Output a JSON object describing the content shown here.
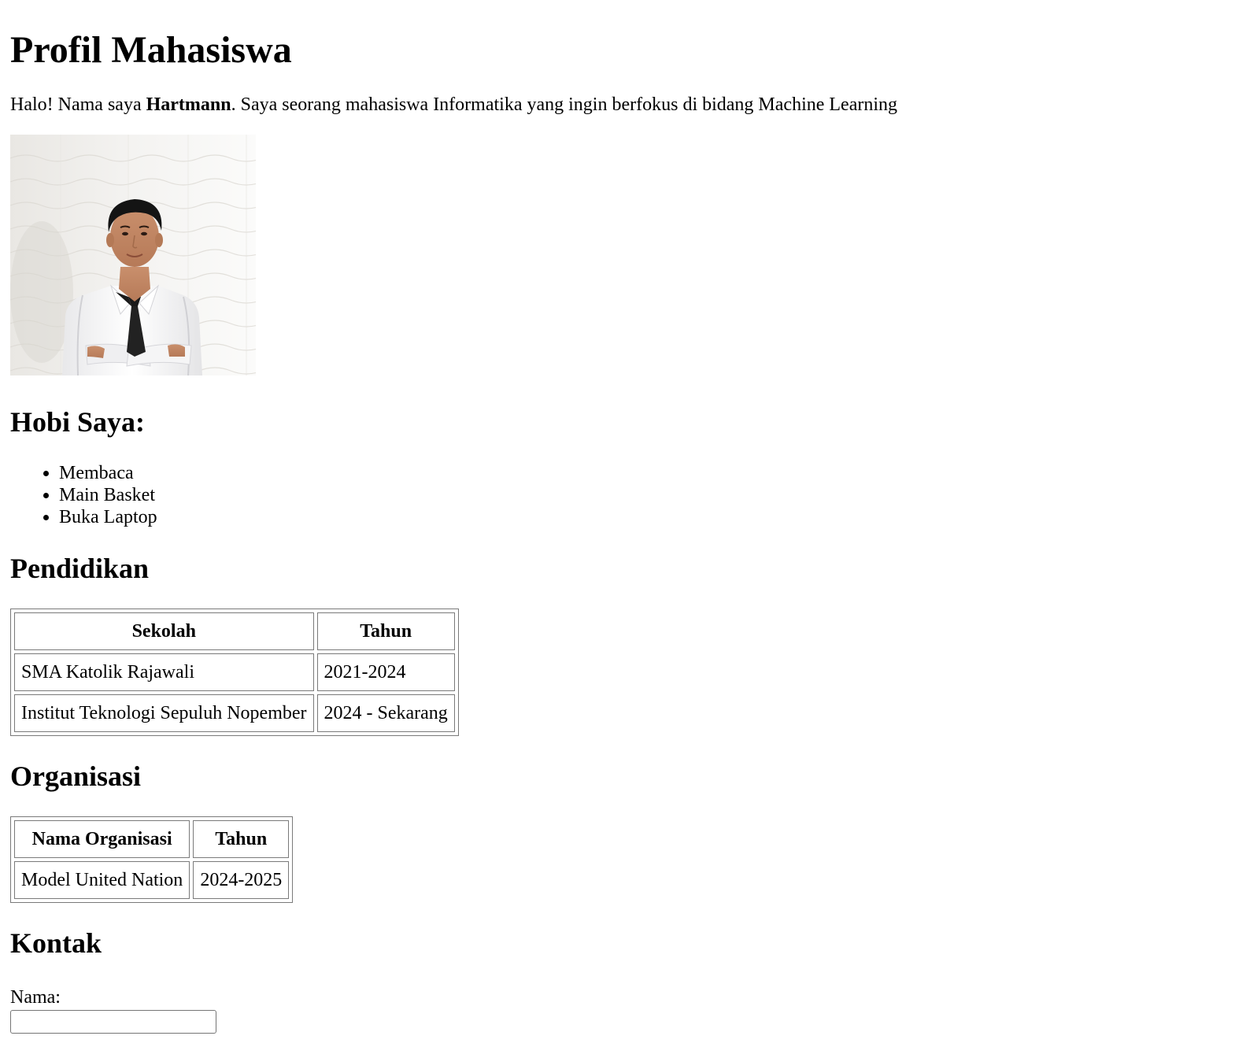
{
  "page": {
    "title": "Profil Mahasiswa"
  },
  "intro": {
    "prefix": "Halo! Nama saya ",
    "name": "Hartmann",
    "suffix": ". Saya seorang mahasiswa Informatika yang ingin berfokus di bidang Machine Learning"
  },
  "photo": {
    "alt": "Profile photo"
  },
  "hobbies": {
    "heading": "Hobi Saya:",
    "items": [
      "Membaca",
      "Main Basket",
      "Buka Laptop"
    ]
  },
  "education": {
    "heading": "Pendidikan",
    "columns": [
      "Sekolah",
      "Tahun"
    ],
    "rows": [
      [
        "SMA Katolik Rajawali",
        "2021-2024"
      ],
      [
        "Institut Teknologi Sepuluh Nopember",
        "2024 - Sekarang"
      ]
    ]
  },
  "organization": {
    "heading": "Organisasi",
    "columns": [
      "Nama Organisasi",
      "Tahun"
    ],
    "rows": [
      [
        "Model United Nation",
        "2024-2025"
      ]
    ]
  },
  "contact": {
    "heading": "Kontak",
    "name_label": "Nama:",
    "name_value": ""
  }
}
